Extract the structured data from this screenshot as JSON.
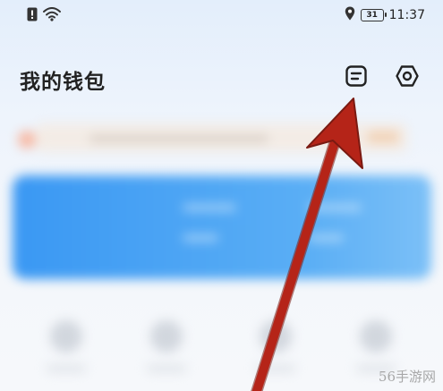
{
  "status_bar": {
    "time": "11:37",
    "battery_level": "31",
    "icons": [
      "alert-icon",
      "wifi-icon",
      "location-icon",
      "battery-icon"
    ]
  },
  "header": {
    "title": "我的钱包",
    "icons": [
      "bill-icon",
      "settings-icon"
    ]
  },
  "annotation": {
    "arrow_color": "#b52418",
    "target": "bill-button"
  },
  "watermark": "56手游网"
}
